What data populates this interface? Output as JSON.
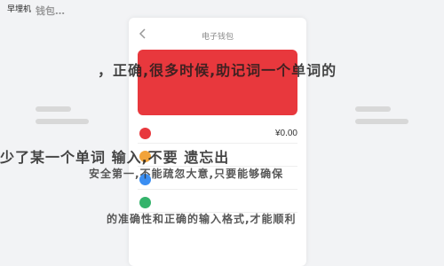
{
  "status_bar": {
    "time": "早埋机"
  },
  "phone": {
    "title": "电子钱包",
    "amount": "¥0.00"
  },
  "watermark": {
    "line0": "钱包…",
    "line1": "，正确,很多时候,助记词一个单词的",
    "line2": "少了某一个单词  输入,不要   遗忘出",
    "line3": "安全第一,不能疏忽大意,只要能够确保",
    "line4": "的准确性和正确的输入格式,才能顺利"
  },
  "colors": {
    "accent": "#e8383d",
    "background": "#f2f3f5"
  }
}
